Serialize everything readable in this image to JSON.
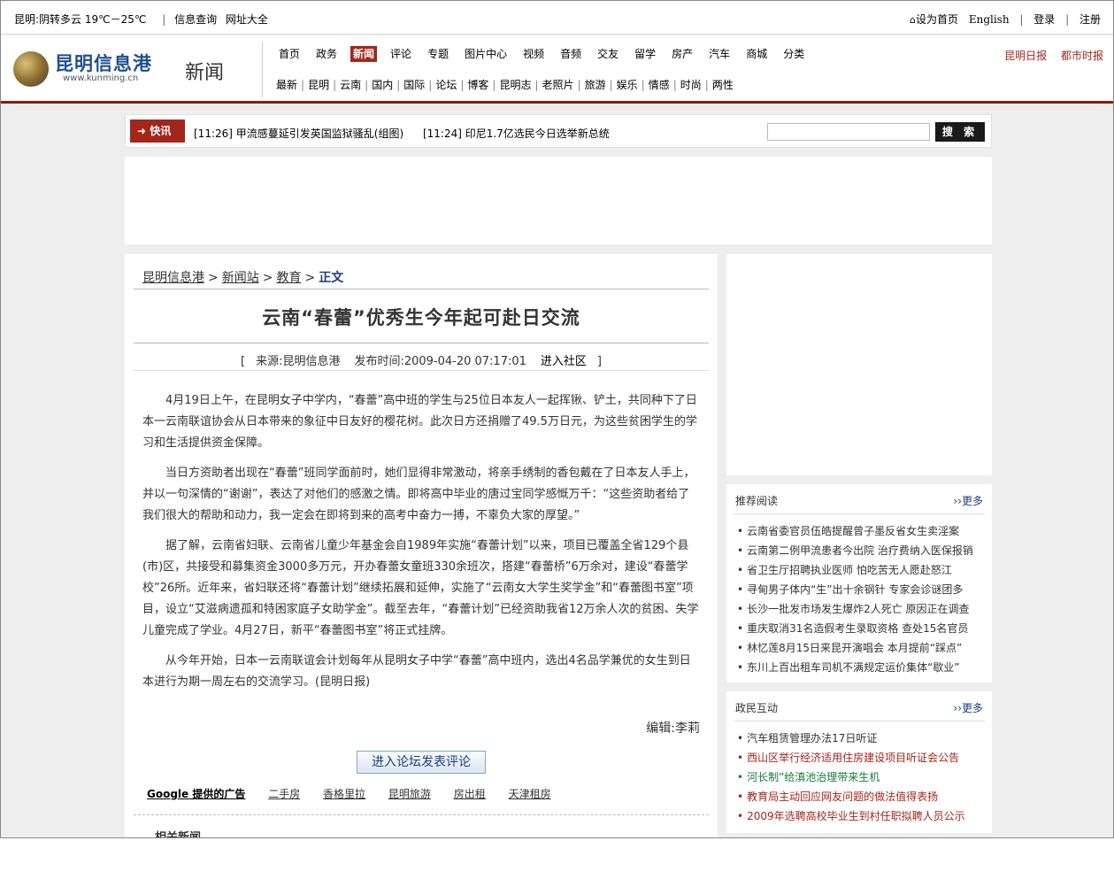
{
  "topbar": {
    "weather": "昆明:阴转多云 19℃－25℃",
    "links": [
      "信息查询",
      "网址大全"
    ],
    "right": {
      "home": "设为首页",
      "english": "English",
      "login": "登录",
      "register": "注册"
    }
  },
  "header": {
    "logo_cn": "昆明信息港",
    "logo_url": "www.kunming.cn",
    "section": "新闻",
    "nav1": [
      "首页",
      "政务",
      "新闻",
      "评论",
      "专题",
      "图片中心",
      "视频",
      "音频",
      "交友",
      "留学",
      "房产",
      "汽车",
      "商城",
      "分类"
    ],
    "nav1_active": "新闻",
    "nav2": [
      "最新",
      "昆明",
      "云南",
      "国内",
      "国际",
      "论坛",
      "博客",
      "昆明志",
      "老照片",
      "旅游",
      "娱乐",
      "情感",
      "时尚",
      "两性"
    ],
    "papers": [
      "昆明日报",
      "都市时报"
    ]
  },
  "flash": {
    "tag": "快讯",
    "items": [
      "[11:26] 甲流感蔓延引发英国监狱骚乱(组图)",
      "[11:24] 印尼1.7亿选民今日选举新总统"
    ],
    "search_label": "搜 索"
  },
  "article": {
    "breadcrumb": [
      "昆明信息港",
      "新闻站",
      "教育"
    ],
    "breadcrumb_current": "正文",
    "title": "云南“春蕾”优秀生今年起可赴日交流",
    "meta_open": "[",
    "source": "来源:昆明信息港",
    "time": "发布时间:2009-04-20 07:17:01",
    "community": "进入社区",
    "meta_close": "]",
    "paragraphs": [
      "4月19日上午，在昆明女子中学内，“春蕾”高中班的学生与25位日本友人一起挥锹、铲土，共同种下了日本一云南联谊协会从日本带来的象征中日友好的樱花树。此次日方还捐赠了49.5万日元，为这些贫困学生的学习和生活提供资金保障。",
      "当日方资助者出现在“春蕾”班同学面前时，她们显得非常激动，将亲手绣制的香包戴在了日本友人手上，并以一句深情的“谢谢”，表达了对他们的感激之情。即将高中毕业的唐过宝同学感慨万千：“这些资助者给了我们很大的帮助和动力，我一定会在即将到来的高考中奋力一搏，不辜负大家的厚望。”",
      "据了解，云南省妇联、云南省儿童少年基金会自1989年实施“春蕾计划”以来，项目已覆盖全省129个县(市)区，共接受和募集资金3000多万元，开办春蕾女童班330余班次，搭建“春蕾桥”6万余对，建设“春蕾学校”26所。近年来，省妇联还将“春蕾计划”继续拓展和延伸，实施了“云南女大学生奖学金”和“春蕾图书室”项目，设立“艾滋病遗孤和特困家庭子女助学金”。截至去年，“春蕾计划”已经资助我省12万余人次的贫困、失学儿童完成了学业。4月27日，新平“春蕾图书室”将正式挂牌。",
      "从今年开始，日本一云南联谊会计划每年从昆明女子中学“春蕾”高中班内，选出4名品学兼优的女生到日本进行为期一周左右的交流学习。(昆明日报)"
    ],
    "editor": "编辑:李莉",
    "forum_button": "进入论坛发表评论",
    "google_ads_label": "Google 提供的广告",
    "ad_links": [
      "二手房",
      "香格里拉",
      "昆明旅游",
      "房出租",
      "天津租房"
    ],
    "related_title": "相关新闻"
  },
  "sidebar": {
    "recommend": {
      "title": "推荐阅读",
      "more": "››更多",
      "items": [
        "云南省委官员伍皓提醒曾子墨反省女生卖淫案",
        "云南第二例甲流患者今出院 治疗费纳入医保报销",
        "省卫生厅招聘执业医师 怕吃苦无人愿赴怒江",
        "寻甸男子体内“生”出十余钢针 专家会诊谜团多",
        "长沙一批发市场发生爆炸2人死亡 原因正在调查",
        "重庆取消31名造假考生录取资格 查处15名官员",
        "林忆莲8月15日来昆开演唱会 本月提前“踩点”",
        "东川上百出租车司机不满规定运价集体“歇业”"
      ]
    },
    "interaction": {
      "title": "政民互动",
      "more": "››更多",
      "items": [
        {
          "text": "汽车租赁管理办法17日听证",
          "color": "default"
        },
        {
          "text": "西山区举行经济适用住房建设项目听证会公告",
          "color": "red"
        },
        {
          "text": "河长制”给滇池治理带来生机",
          "color": "green"
        },
        {
          "text": "教育局主动回应网友问题的做法值得表扬",
          "color": "red"
        },
        {
          "text": "2009年选聘高校毕业生到村任职拟聘人员公示",
          "color": "red"
        }
      ]
    }
  },
  "colors": {
    "brand_red": "#a3261a",
    "link_blue": "#1a3e7c",
    "header_border": "#8b1a10"
  }
}
